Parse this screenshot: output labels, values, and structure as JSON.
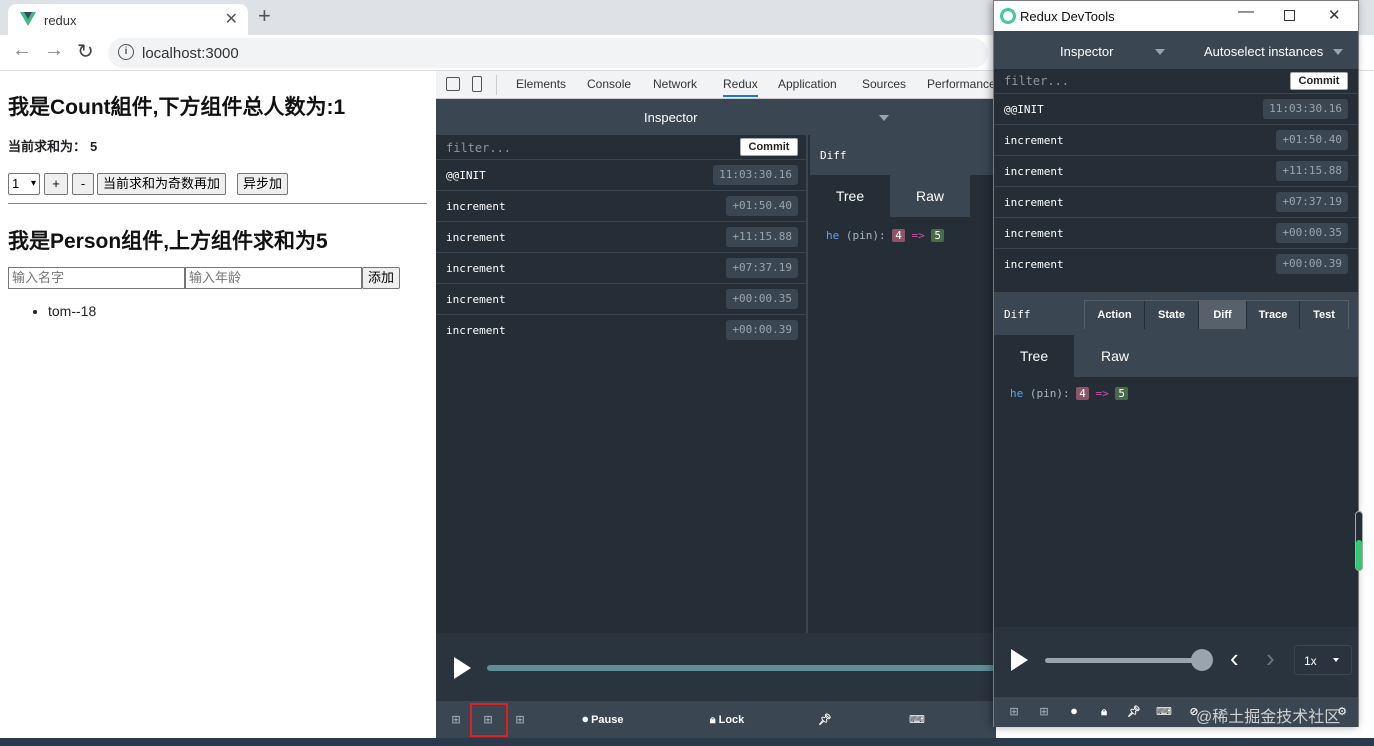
{
  "browser": {
    "tab_title": "redux",
    "url": "localhost:3000"
  },
  "page": {
    "count_heading": "我是Count組件,下方组件总人数为:1",
    "sum_label": "当前求和为：",
    "sum_value": "5",
    "select_value": "1",
    "plus_label": "+",
    "minus_label": "-",
    "odd_add_label": "当前求和为奇数再加",
    "async_add_label": "异步加",
    "person_heading": "我是Person组件,上方组件求和为5",
    "name_placeholder": "输入名字",
    "age_placeholder": "输入年龄",
    "add_label": "添加",
    "persons": [
      "tom--18"
    ]
  },
  "devtools": {
    "tabs": [
      "Elements",
      "Console",
      "Network",
      "Redux",
      "Application",
      "Sources",
      "Performance"
    ],
    "active_tab": "Redux",
    "monitor_label": "Inspector",
    "filter_placeholder": "filter...",
    "commit_label": "Commit",
    "actions": [
      {
        "name": "@@INIT",
        "time": "11:03:30.16"
      },
      {
        "name": "increment",
        "time": "+01:50.40"
      },
      {
        "name": "increment",
        "time": "+11:15.88"
      },
      {
        "name": "increment",
        "time": "+07:37.19"
      },
      {
        "name": "increment",
        "time": "+00:00.35"
      },
      {
        "name": "increment",
        "time": "+00:00.39"
      }
    ],
    "diff_title": "Diff",
    "tree_label": "Tree",
    "raw_label": "Raw",
    "diff": {
      "key": "he",
      "pin": "(pin):",
      "old": "4",
      "arrow": "=>",
      "new": "5"
    },
    "pause_label": "Pause",
    "lock_label": "Lock"
  },
  "window": {
    "title": "Redux DevTools",
    "monitor_label": "Inspector",
    "instances_label": "Autoselect instances",
    "filter_placeholder": "filter...",
    "commit_label": "Commit",
    "actions": [
      {
        "name": "@@INIT",
        "time": "11:03:30.16"
      },
      {
        "name": "increment",
        "time": "+01:50.40"
      },
      {
        "name": "increment",
        "time": "+11:15.88"
      },
      {
        "name": "increment",
        "time": "+07:37.19"
      },
      {
        "name": "increment",
        "time": "+00:00.35"
      },
      {
        "name": "increment",
        "time": "+00:00.39"
      }
    ],
    "diff_title": "Diff",
    "tabs": [
      "Action",
      "State",
      "Diff",
      "Trace",
      "Test"
    ],
    "active_tab": "Diff",
    "tree_label": "Tree",
    "raw_label": "Raw",
    "diff": {
      "key": "he",
      "pin": "(pin):",
      "old": "4",
      "arrow": "=>",
      "new": "5"
    },
    "speed_label": "1x",
    "slider_position": 1.0
  },
  "watermark": "@稀土掘金技术社区",
  "colors": {
    "accent": "#1a73e8",
    "devtools_bg": "#252e37",
    "panel": "#3a4651",
    "highlight": "#e02020",
    "slider": "#5f8e95"
  }
}
